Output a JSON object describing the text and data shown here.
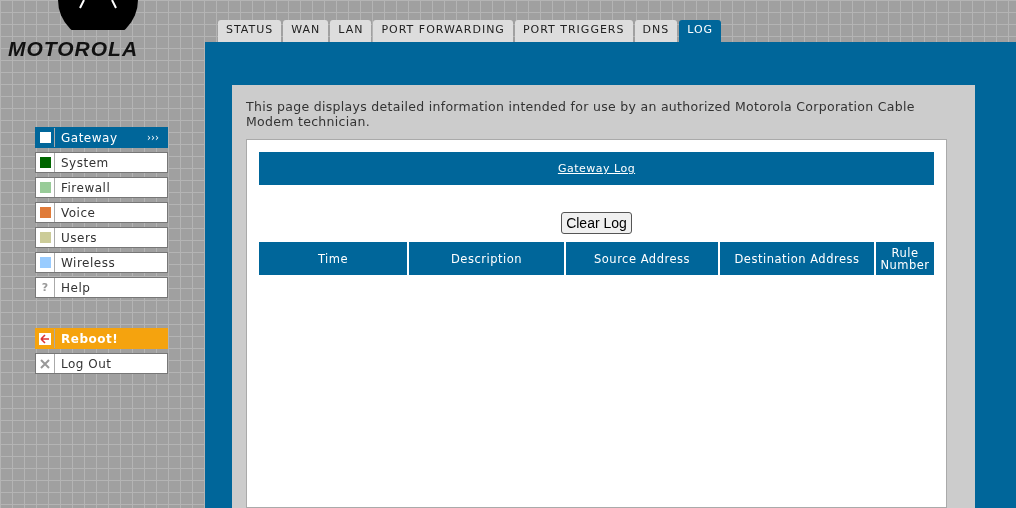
{
  "logo": {
    "text": "MOTOROLA"
  },
  "tabs": [
    {
      "label": "STATUS",
      "selected": false
    },
    {
      "label": "WAN",
      "selected": false
    },
    {
      "label": "LAN",
      "selected": false
    },
    {
      "label": "PORT FORWARDING",
      "selected": false
    },
    {
      "label": "PORT TRIGGERS",
      "selected": false
    },
    {
      "label": "DNS",
      "selected": false
    },
    {
      "label": "LOG",
      "selected": true
    }
  ],
  "sidebar": {
    "items": [
      {
        "label": "Gateway",
        "kind": "color",
        "color": "#ffffff",
        "selected": true,
        "arrow": "›››"
      },
      {
        "label": "System",
        "kind": "color",
        "color": "#006600",
        "selected": false
      },
      {
        "label": "Firewall",
        "kind": "color",
        "color": "#99cc99",
        "selected": false
      },
      {
        "label": "Voice",
        "kind": "color",
        "color": "#e07b39",
        "selected": false
      },
      {
        "label": "Users",
        "kind": "color",
        "color": "#cccc99",
        "selected": false
      },
      {
        "label": "Wireless",
        "kind": "color",
        "color": "#99ccff",
        "selected": false
      },
      {
        "label": "Help",
        "kind": "glyph",
        "glyph": "?",
        "selected": false
      }
    ],
    "actions": [
      {
        "label": "Reboot!",
        "kind": "reboot"
      },
      {
        "label": "Log Out",
        "kind": "logout"
      }
    ]
  },
  "intro": "This page displays detailed information intended for use by an authorized Motorola Corporation Cable Modem technician.",
  "section_title": "Gateway Log",
  "button": "Clear Log",
  "table": {
    "columns": [
      "Time",
      "Description",
      "Source Address",
      "Destination Address",
      "Rule Number"
    ]
  }
}
